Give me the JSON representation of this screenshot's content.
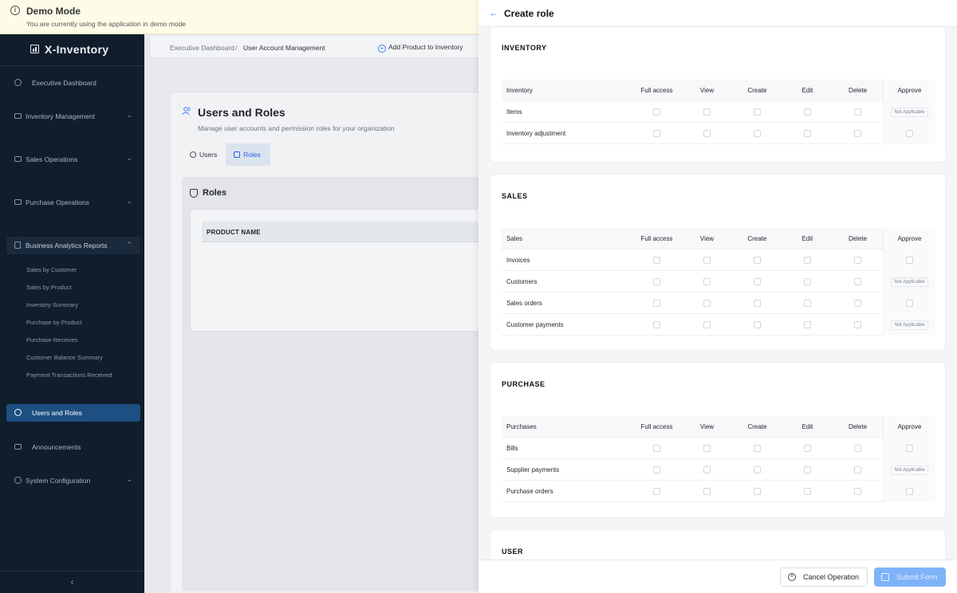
{
  "banner": {
    "title": "Demo Mode",
    "subtitle": "You are currently using the application in demo mode"
  },
  "sidebar": {
    "brand": "X-Inventory",
    "items": {
      "exec": "Executive Dashboard",
      "inventory": "Inventory Management",
      "sales": "Sales Operations",
      "purchase": "Purchase Operations",
      "reports": "Business Analytics Reports",
      "users": "Users and Roles",
      "announcements": "Announcements",
      "system": "System Configuration"
    },
    "report_subitems": [
      "Sales by Customer",
      "Sales by Product",
      "Inventory Summary",
      "Purchase by Product",
      "Purchase Receives",
      "Customer Balance Summary",
      "Payment Transactions Received"
    ]
  },
  "topbar": {
    "crumb1": "Executive Dashboard",
    "sep": "/",
    "crumb2": "User Account Management",
    "add_product": "Add Product to Inventory"
  },
  "page": {
    "title": "Users and Roles",
    "subtitle": "Manage user accounts and permission roles for your organization",
    "tab_users": "Users",
    "tab_roles": "Roles",
    "roles_title": "Roles",
    "col_product": "PRODUCT NAME"
  },
  "drawer": {
    "title": "Create role",
    "columns": {
      "full": "Full access",
      "view": "View",
      "create": "Create",
      "edit": "Edit",
      "delete": "Delete",
      "approve": "Approve"
    },
    "na": "Not Applicable",
    "sections": {
      "inventory": {
        "title": "INVENTORY",
        "head": "Inventory",
        "rows": [
          "Items",
          "Inventory adjustment"
        ]
      },
      "sales": {
        "title": "SALES",
        "head": "Sales",
        "rows": [
          "Invoices",
          "Customers",
          "Sales orders",
          "Customer payments"
        ]
      },
      "purchase": {
        "title": "PURCHASE",
        "head": "Purchases",
        "rows": [
          "Bills",
          "Supplier payments",
          "Purchase orders"
        ]
      },
      "user": {
        "title": "USER"
      }
    },
    "cancel": "Cancel Operation",
    "submit": "Submit Form"
  }
}
